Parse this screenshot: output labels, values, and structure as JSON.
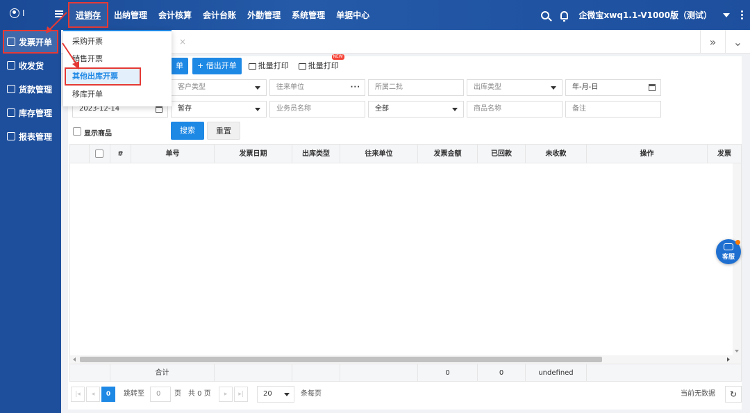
{
  "header": {
    "user_name": "I",
    "nav": [
      "进销存",
      "出纳管理",
      "会计核算",
      "会计台账",
      "外勤管理",
      "系统管理",
      "单据中心"
    ],
    "account": "企微宝xwq1.1-V1000版（测试）"
  },
  "sidebar": {
    "items": [
      "发票开单",
      "收发货",
      "货款管理",
      "库存管理",
      "报表管理"
    ]
  },
  "dropdown": {
    "items": [
      "采购开票",
      "销售开票",
      "其他出库开票",
      "移库开单"
    ]
  },
  "toolbar": {
    "new_label": "单",
    "lend_out_label": "+ 借出开单",
    "batch_print_1": "批量打印",
    "batch_print_2": "批量打印",
    "new_badge": "NEW"
  },
  "tab": {
    "close": "×"
  },
  "filters": {
    "customer_type": "客户类型",
    "partner": "往来单位",
    "batch": "所属二批",
    "outbound_type": "出库类型",
    "date_placeholder": "年-月-日",
    "date_value": "2023-12-14",
    "status": "暂存",
    "salesperson": "业务员名称",
    "all": "全部",
    "product_name": "商品名称",
    "remark": "备注",
    "show_products": "显示商品",
    "search": "搜索",
    "reset": "重置"
  },
  "table": {
    "headers": [
      "#",
      "单号",
      "发票日期",
      "出库类型",
      "往来单位",
      "发票金额",
      "已回款",
      "未收款",
      "操作",
      "发票"
    ],
    "footer": {
      "total_label": "合计",
      "invoice_amount": "0",
      "received": "0",
      "unreceived": "undefined"
    }
  },
  "pager": {
    "current": "0",
    "jump_to": "跳转至",
    "jump_value": "0",
    "page_unit": "页",
    "total": "共 0 页",
    "page_size": "20",
    "per_page": "条每页",
    "no_data": "当前无数据"
  },
  "chat": {
    "label": "客服"
  },
  "colors": {
    "accent": "#1e88e5",
    "highlight": "#e53935",
    "brand": "#1a4a96"
  }
}
